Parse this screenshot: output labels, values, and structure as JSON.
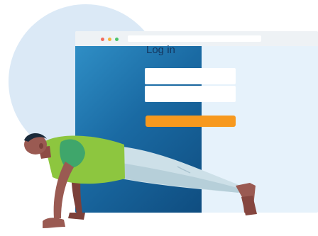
{
  "login": {
    "title": "Log in",
    "username_placeholder": "",
    "password_placeholder": ""
  },
  "browser": {
    "dots": [
      "#f26b5b",
      "#f5b43c",
      "#4cc46a"
    ]
  },
  "colors": {
    "accent": "#f7991e",
    "title": "#14365e",
    "panel_blue": "#1a6aa3",
    "circle": "#dbe9f6"
  },
  "illustration": {
    "subject": "person-doing-pushup-icon"
  }
}
